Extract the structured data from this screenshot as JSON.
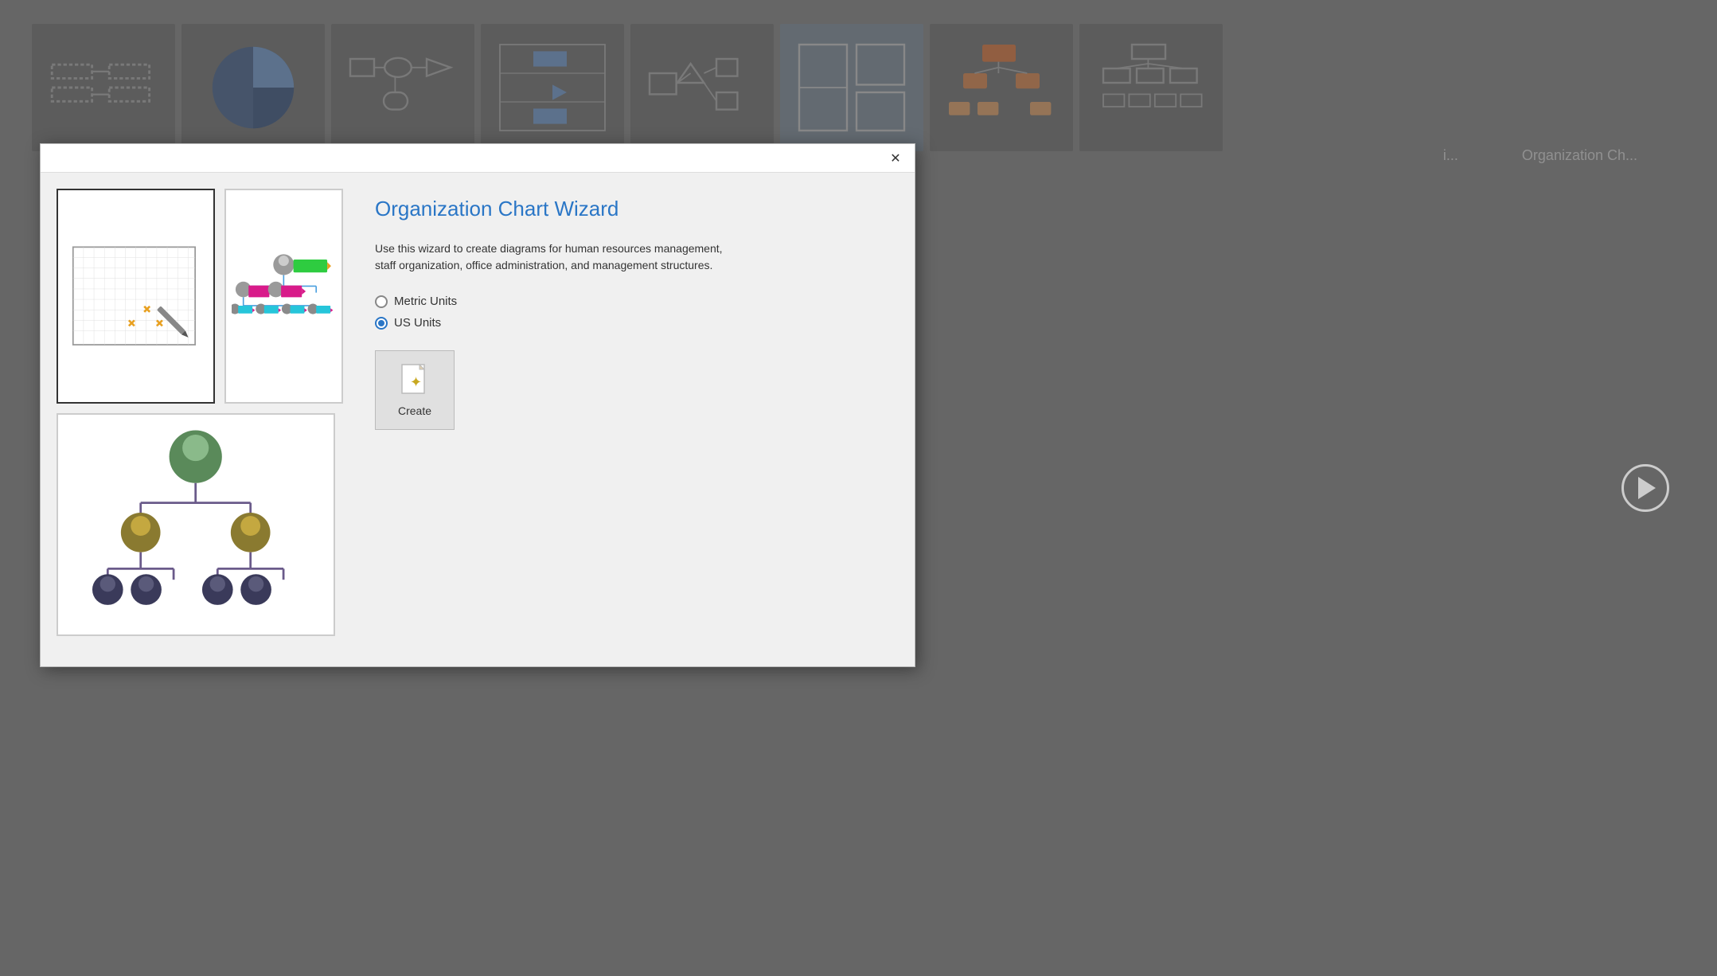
{
  "background": {
    "thumbnails": [
      {
        "name": "flowchart-thumb",
        "label": ""
      },
      {
        "name": "pie-thumb",
        "label": ""
      },
      {
        "name": "process-thumb",
        "label": ""
      },
      {
        "name": "swimlane-thumb",
        "label": ""
      },
      {
        "name": "network-thumb",
        "label": ""
      },
      {
        "name": "floor-thumb",
        "label": ""
      },
      {
        "name": "orgchart-color-thumb",
        "label": ""
      },
      {
        "name": "orgchart-thumb",
        "label": ""
      }
    ],
    "label1": "i...",
    "label2": "Organization Ch..."
  },
  "dialog": {
    "title": "Organization Chart Wizard",
    "description": "Use this wizard to create diagrams for human resources management, staff organization, office administration, and management structures.",
    "units": {
      "metric": {
        "label": "Metric Units",
        "selected": false
      },
      "us": {
        "label": "US Units",
        "selected": true
      }
    },
    "create_button": "Create",
    "close_icon": "✕"
  }
}
